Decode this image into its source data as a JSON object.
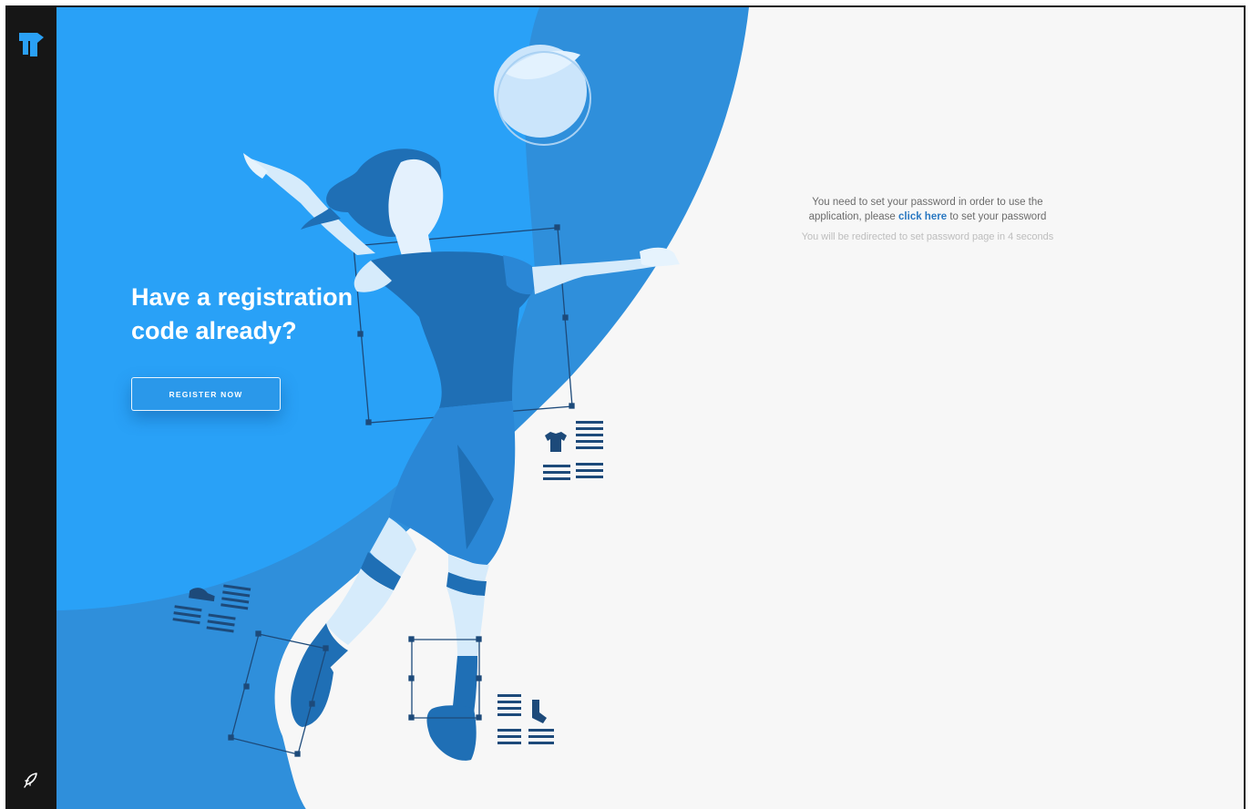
{
  "hero": {
    "title_line1": "Have a registration",
    "title_line2": "code already?",
    "register_button": "REGISTER NOW"
  },
  "message": {
    "text_before_line": "You need to set your password in order to use the",
    "text_before": "application, please",
    "link_text": "click here",
    "text_after": "to set your password",
    "redirect_text": "You will be redirected to set password page in 4 seconds"
  },
  "sidebar": {
    "logo_icon": "app-logo-icon",
    "bottom_icon": "rocket-icon"
  },
  "colors": {
    "sidebar_bg": "#161616",
    "hero_blue": "#2aa0f5",
    "dark_blue": "#1f75bd",
    "link_blue": "#2b79c2",
    "page_bg": "#f7f7f7"
  }
}
